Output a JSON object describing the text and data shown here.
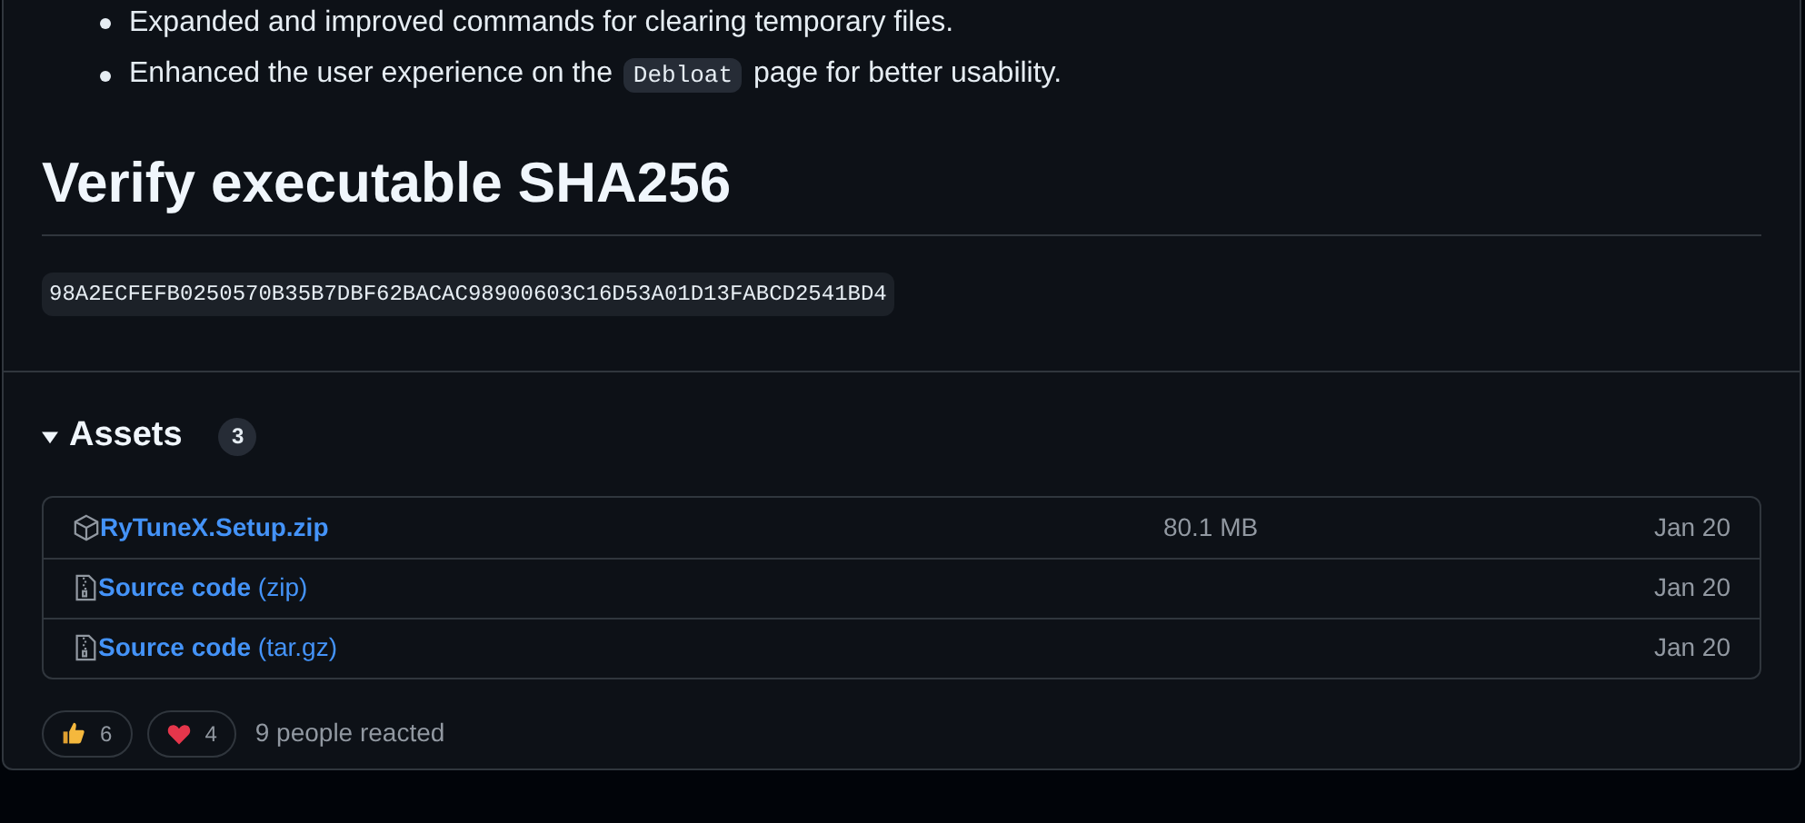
{
  "notes": [
    {
      "text": "Expanded and improved commands for clearing temporary files."
    },
    {
      "before": "Enhanced the user experience on the ",
      "code": "Debloat",
      "after": " page for better usability."
    }
  ],
  "heading": "Verify executable SHA256",
  "hash": "98A2ECFEFB0250570B35B7DBF62BACAC98900603C16D53A01D13FABCD2541BD4",
  "assets": {
    "title": "Assets",
    "count": "3",
    "expanded": true,
    "items": [
      {
        "kind": "package",
        "name": "RyTuneX.Setup.zip",
        "size": "80.1 MB",
        "date": "Jan 20"
      },
      {
        "kind": "source",
        "name": "Source code",
        "suffix": "(zip)",
        "date": "Jan 20"
      },
      {
        "kind": "source",
        "name": "Source code",
        "suffix": "(tar.gz)",
        "date": "Jan 20"
      }
    ]
  },
  "reactions": [
    {
      "kind": "thumbs_up",
      "count": "6"
    },
    {
      "kind": "heart",
      "count": "4"
    }
  ],
  "reaction_summary": "9 people reacted"
}
